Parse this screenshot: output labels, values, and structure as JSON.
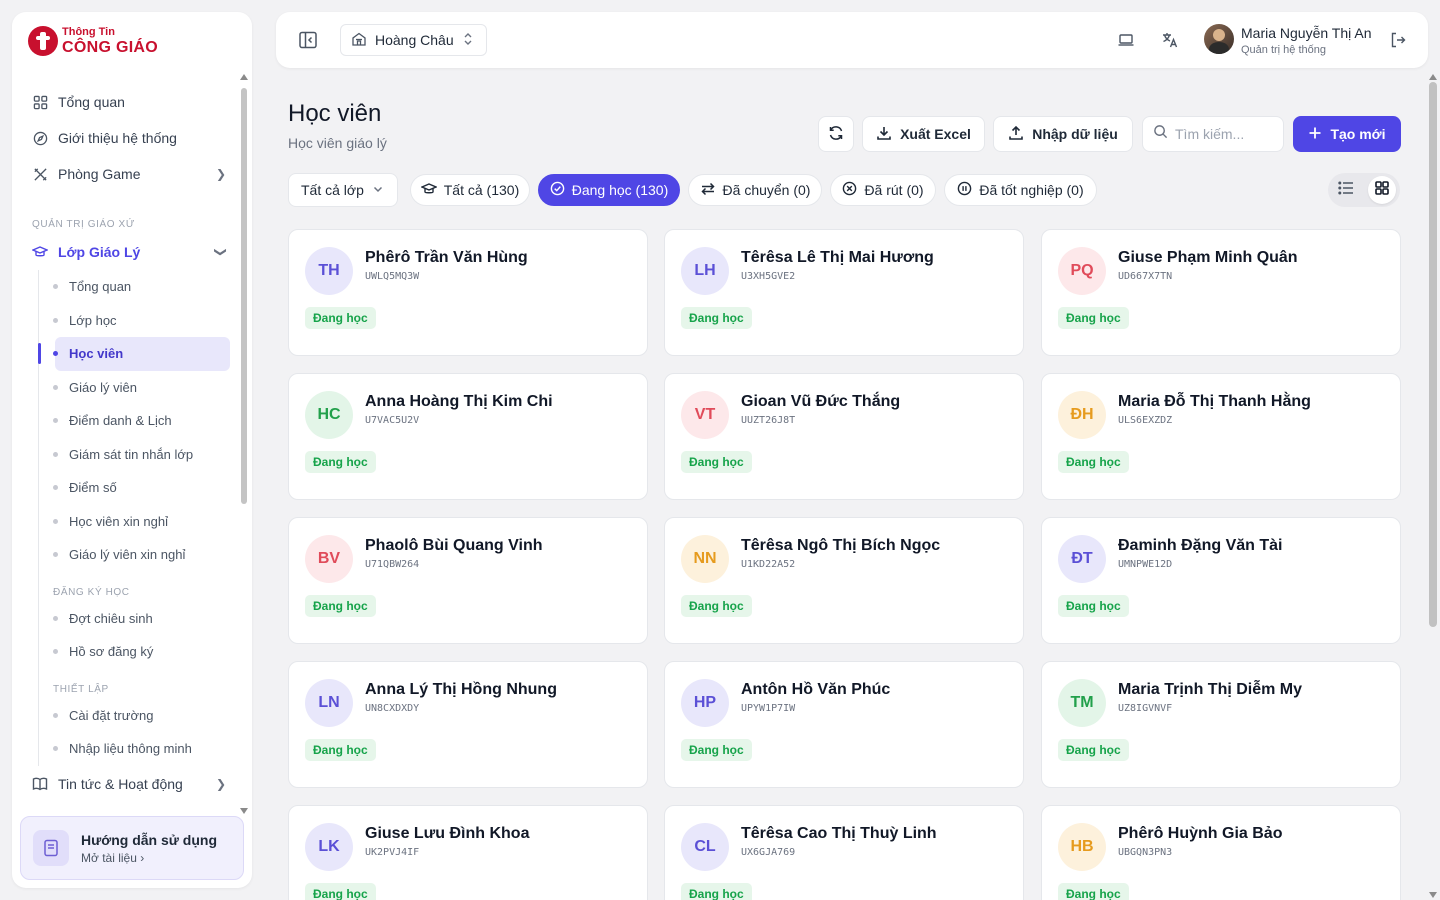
{
  "app": {
    "logo_small": "Thông Tin",
    "logo_big": "CÔNG GIÁO",
    "brand_color": "#c8102e",
    "accent_color": "#4f46e5"
  },
  "sidebar": {
    "top_items": [
      {
        "label": "Tổng quan",
        "icon": "dashboard-grid-icon"
      },
      {
        "label": "Giới thiệu hệ thống",
        "icon": "compass-icon"
      },
      {
        "label": "Phòng Game",
        "icon": "crossed-tools-icon"
      }
    ],
    "section_label": "QUẢN TRỊ GIÁO XỨ",
    "group": {
      "label": "Lớp Giáo Lý",
      "icon": "graduation-cap-icon",
      "items": [
        {
          "label": "Tổng quan"
        },
        {
          "label": "Lớp học"
        },
        {
          "label": "Học viên"
        },
        {
          "label": "Giáo lý viên"
        },
        {
          "label": "Điểm danh & Lịch"
        },
        {
          "label": "Giám sát tin nhắn lớp"
        },
        {
          "label": "Điểm số"
        },
        {
          "label": "Học viên xin nghỉ"
        },
        {
          "label": "Giáo lý viên xin nghỉ"
        }
      ],
      "sub_section_1": "ĐĂNG KÝ HỌC",
      "items_2": [
        {
          "label": "Đợt chiêu sinh"
        },
        {
          "label": "Hồ sơ đăng ký"
        }
      ],
      "sub_section_2": "THIẾT LẬP",
      "items_3": [
        {
          "label": "Cài đặt trường"
        },
        {
          "label": "Nhập liệu thông minh"
        }
      ]
    },
    "bottom_item": {
      "label": "Tin tức & Hoạt động",
      "icon": "book-icon"
    },
    "guide": {
      "title": "Hướng dẫn sử dụng",
      "subtitle": "Mở tài liệu ›",
      "icon": "document-icon"
    }
  },
  "header": {
    "parish": "Hoàng Châu",
    "user_name": "Maria Nguyễn Thị An",
    "user_role": "Quản trị hệ thống"
  },
  "page": {
    "title": "Học viên",
    "subtitle": "Học viên giáo lý",
    "refresh_icon": "refresh-icon",
    "export_label": "Xuất Excel",
    "import_label": "Nhập dữ liệu",
    "search_placeholder": "Tìm kiếm...",
    "create_label": "Tạo mới"
  },
  "filters": {
    "class_select": "Tất cả lớp",
    "tabs": [
      {
        "label": "Tất cả (130)",
        "icon": "graduation-cap-icon"
      },
      {
        "label": "Đang học (130)",
        "icon": "check-circle-icon",
        "active": true
      },
      {
        "label": "Đã chuyển (0)",
        "icon": "swap-icon"
      },
      {
        "label": "Đã rút (0)",
        "icon": "x-circle-icon"
      },
      {
        "label": "Đã tốt nghiệp (0)",
        "icon": "pause-circle-icon"
      }
    ]
  },
  "students": [
    {
      "initials": "TH",
      "name": "Phêrô Trần Văn Hùng",
      "code": "UWLQ5MQ3W",
      "status": "Đang học",
      "bg": "#e8e7fb",
      "fg": "#5b50d6"
    },
    {
      "initials": "LH",
      "name": "Têrêsa Lê Thị Mai Hương",
      "code": "U3XH5GVE2",
      "status": "Đang học",
      "bg": "#e8e7fb",
      "fg": "#5b50d6"
    },
    {
      "initials": "PQ",
      "name": "Giuse Phạm Minh Quân",
      "code": "UD667X7TN",
      "status": "Đang học",
      "bg": "#fde8ea",
      "fg": "#e04b5a"
    },
    {
      "initials": "HC",
      "name": "Anna Hoàng Thị Kim Chi",
      "code": "U7VAC5U2V",
      "status": "Đang học",
      "bg": "#e3f5e8",
      "fg": "#22a04b"
    },
    {
      "initials": "VT",
      "name": "Gioan Vũ Đức Thắng",
      "code": "UUZT26J8T",
      "status": "Đang học",
      "bg": "#fde8ea",
      "fg": "#e04b5a"
    },
    {
      "initials": "ĐH",
      "name": "Maria Đỗ Thị Thanh Hằng",
      "code": "ULS6EXZDZ",
      "status": "Đang học",
      "bg": "#fdf1dc",
      "fg": "#e69b1e"
    },
    {
      "initials": "BV",
      "name": "Phaolô Bùi Quang Vinh",
      "code": "U71QBW264",
      "status": "Đang học",
      "bg": "#fde8ea",
      "fg": "#e04b5a"
    },
    {
      "initials": "NN",
      "name": "Têrêsa Ngô Thị Bích Ngọc",
      "code": "U1KD22A52",
      "status": "Đang học",
      "bg": "#fdf1dc",
      "fg": "#e69b1e"
    },
    {
      "initials": "ĐT",
      "name": "Đaminh Đặng Văn Tài",
      "code": "UMNPWE12D",
      "status": "Đang học",
      "bg": "#e8e7fb",
      "fg": "#5b50d6"
    },
    {
      "initials": "LN",
      "name": "Anna Lý Thị Hồng Nhung",
      "code": "UN8CXDXDY",
      "status": "Đang học",
      "bg": "#e8e7fb",
      "fg": "#5b50d6"
    },
    {
      "initials": "HP",
      "name": "Antôn Hồ Văn Phúc",
      "code": "UPYW1P7IW",
      "status": "Đang học",
      "bg": "#e8e7fb",
      "fg": "#5b50d6"
    },
    {
      "initials": "TM",
      "name": "Maria Trịnh Thị Diễm My",
      "code": "UZ8IGVNVF",
      "status": "Đang học",
      "bg": "#e3f5e8",
      "fg": "#22a04b"
    },
    {
      "initials": "LK",
      "name": "Giuse Lưu Đình Khoa",
      "code": "UK2PVJ4IF",
      "status": "Đang học",
      "bg": "#e8e7fb",
      "fg": "#5b50d6"
    },
    {
      "initials": "CL",
      "name": "Têrêsa Cao Thị Thuỳ Linh",
      "code": "UX6GJA769",
      "status": "Đang học",
      "bg": "#e8e7fb",
      "fg": "#5b50d6"
    },
    {
      "initials": "HB",
      "name": "Phêrô Huỳnh Gia Bảo",
      "code": "UBGQN3PN3",
      "status": "Đang học",
      "bg": "#fdf1dc",
      "fg": "#e69b1e"
    }
  ]
}
